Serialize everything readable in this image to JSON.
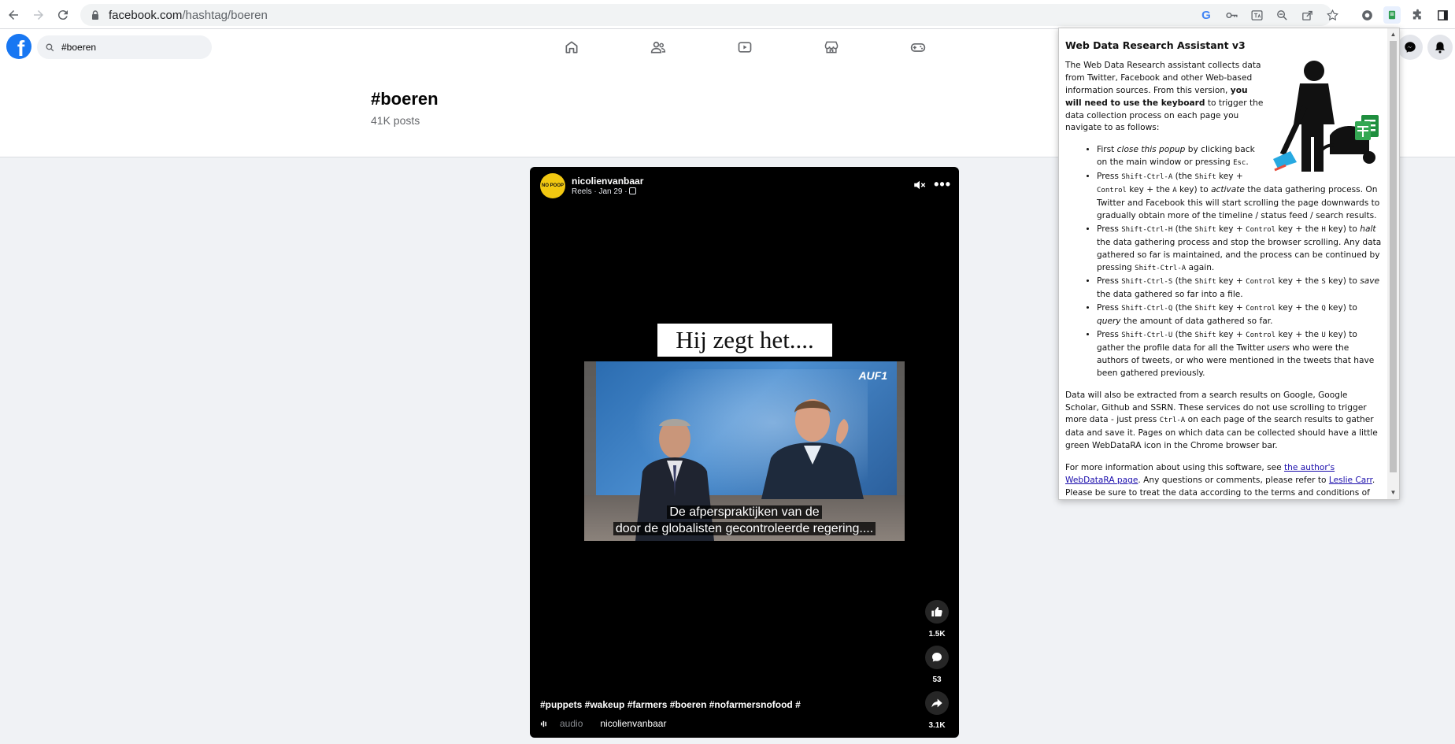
{
  "browser": {
    "url_host": "facebook.com",
    "url_path": "/hashtag/boeren"
  },
  "facebook": {
    "search_value": "#boeren"
  },
  "hashtag": {
    "title": "#boeren",
    "post_count": "41K posts"
  },
  "reel": {
    "author": "nicolienvanbaar",
    "meta": "Reels · Jan 29 · ",
    "avatar_text": "NO POOP",
    "caption_box": "Hij zegt het....",
    "watermark": "AUF1",
    "subtitle_line1": "De afperspraktijken van de",
    "subtitle_line2": "door de globalisten gecontroleerde regering....",
    "likes": "1.5K",
    "comments": "53",
    "shares": "3.1K",
    "hashtags": "#puppets #wakeup #farmers #boeren #nofarmersnofood #",
    "audio_label": "audio",
    "audio_author": "nicolienvanbaar"
  },
  "popup": {
    "title": "Web Data Research Assistant v3",
    "intro_1": "The Web Data Research assistant collects data from Twitter, Facebook and other Web-based information sources. From this version, ",
    "intro_bold": "you will need to use the keyboard",
    "intro_2": " to trigger the data collection process on each page you navigate to as follows:",
    "li1_a": "First ",
    "li1_em": "close this popup",
    "li1_b": " by clicking back on the main window or pressing ",
    "li1_code": "Esc",
    "li1_c": ".",
    "li2_a": "Press ",
    "li2_code1": "Shift-Ctrl-A",
    "li2_b": " (the ",
    "li2_code2": "Shift",
    "li2_c": " key + ",
    "li2_code3": "Control",
    "li2_d": " key + the ",
    "li2_code4": "A",
    "li2_e": " key) to ",
    "li2_em": "activate",
    "li2_f": " the data gathering process. On Twitter and Facebook this will start scrolling the page downwards to gradually obtain more of the timeline / status feed / search results.",
    "li3_a": "Press ",
    "li3_code1": "Shift-Ctrl-H",
    "li3_b": " (the ",
    "li3_code2": "Shift",
    "li3_c": " key + ",
    "li3_code3": "Control",
    "li3_d": " key + the ",
    "li3_code4": "H",
    "li3_e": " key) to ",
    "li3_em": "halt",
    "li3_f": " the data gathering process and stop the browser scrolling. Any data gathered so far is maintained, and the process can be continued by pressing ",
    "li3_code5": "Shift-Ctrl-A",
    "li3_g": " again.",
    "li4_a": "Press ",
    "li4_code1": "Shift-Ctrl-S",
    "li4_b": " (the ",
    "li4_code2": "Shift",
    "li4_c": " key + ",
    "li4_code3": "Control",
    "li4_d": " key + the ",
    "li4_code4": "S",
    "li4_e": " key) to ",
    "li4_em": "save",
    "li4_f": " the data gathered so far into a file.",
    "li5_a": "Press ",
    "li5_code1": "Shift-Ctrl-Q",
    "li5_b": " (the ",
    "li5_code2": "Shift",
    "li5_c": " key + ",
    "li5_code3": "Control",
    "li5_d": " key + the ",
    "li5_code4": "Q",
    "li5_e": " key) to ",
    "li5_em": "query",
    "li5_f": " the amount of data gathered so far.",
    "li6_a": "Press ",
    "li6_code1": "Shift-Ctrl-U",
    "li6_b": " (the ",
    "li6_code2": "Shift",
    "li6_c": " key + ",
    "li6_code3": "Control",
    "li6_d": " key + the ",
    "li6_code4": "U",
    "li6_e": " key) to gather the profile data for all the Twitter ",
    "li6_em": "users",
    "li6_f": " who were the authors of tweets, or who were mentioned in the tweets that have been gathered previously.",
    "para2_a": "Data will also be extracted from a search results on Google, Google Scholar, Github and SSRN. These services do not use scrolling to trigger more data - just press ",
    "para2_code": "Ctrl-A",
    "para2_b": " on each page of the search results to gather data and save it. Pages on which data can be collected should have a little green WebDataRA icon in the Chrome browser bar.",
    "para3_a": "For more information about using this software, see ",
    "para3_link1": "the author's WebDataRA page",
    "para3_b": ". Any questions or comments, please refer to ",
    "para3_link2": "Leslie Carr",
    "para3_c": ". Please be sure to treat the data according to the terms and conditions of the"
  },
  "colors": {
    "facebook_blue": "#1877f2",
    "link": "#1a0dab"
  }
}
